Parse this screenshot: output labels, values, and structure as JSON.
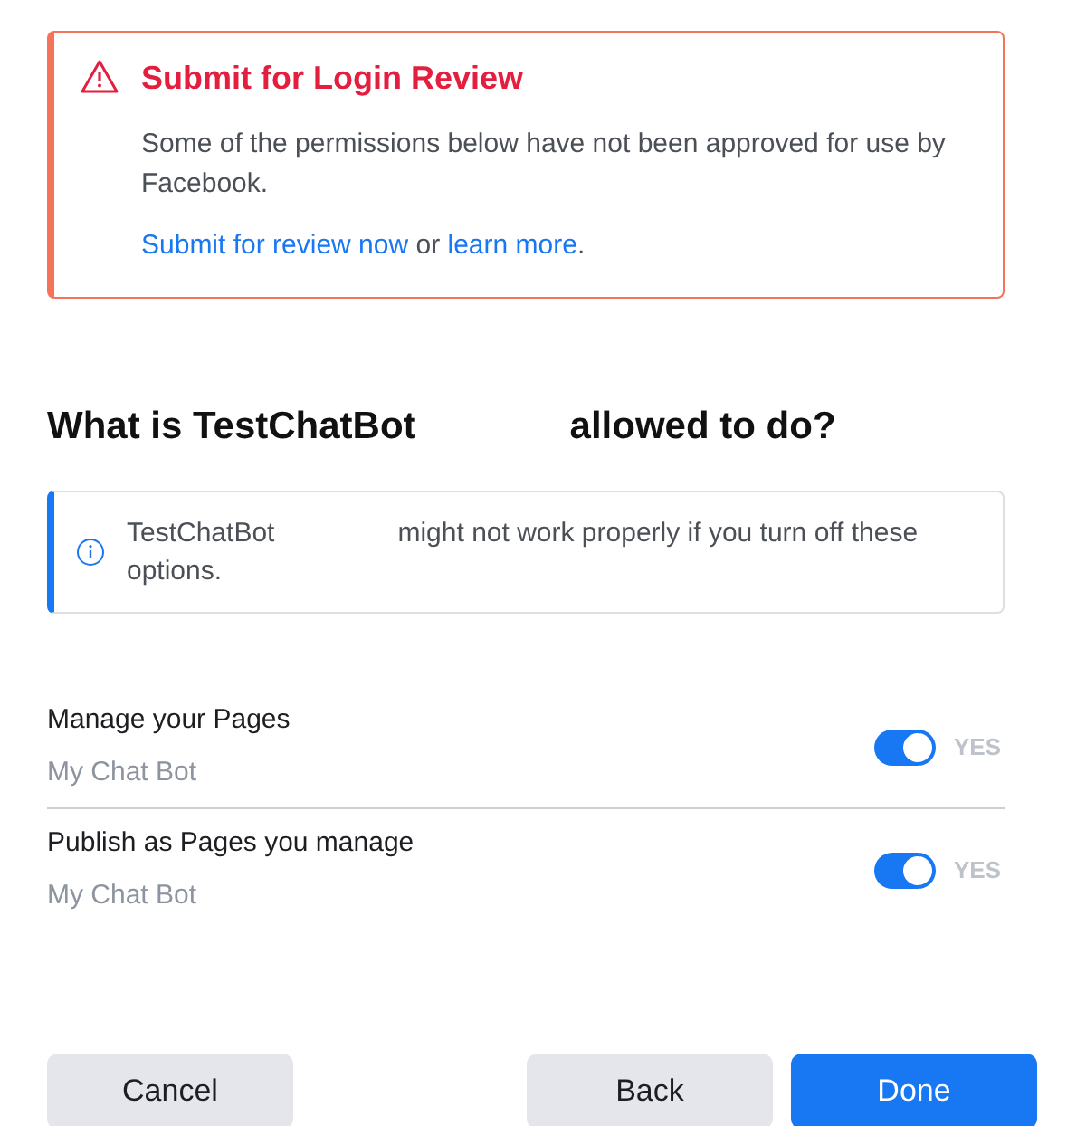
{
  "alert": {
    "title": "Submit for Login Review",
    "body": "Some of the permissions below have not been approved for use by Facebook.",
    "link_primary": "Submit for review now",
    "joiner": " or ",
    "link_secondary": "learn more",
    "end": "."
  },
  "heading": {
    "start": "What is TestChatBot",
    "end": "allowed to do?"
  },
  "notice": {
    "start": "TestChatBot",
    "end": "might not work properly if you turn off these options."
  },
  "permissions": [
    {
      "name": "Manage your Pages",
      "page": "My Chat Bot",
      "on": true,
      "state_label": "YES"
    },
    {
      "name": "Publish as Pages you manage",
      "page": "My Chat Bot",
      "on": true,
      "state_label": "YES"
    }
  ],
  "buttons": [
    {
      "label": "Cancel",
      "kind": "secondary"
    },
    {
      "label": "Back",
      "kind": "secondary"
    },
    {
      "label": "Done",
      "kind": "primary"
    }
  ]
}
